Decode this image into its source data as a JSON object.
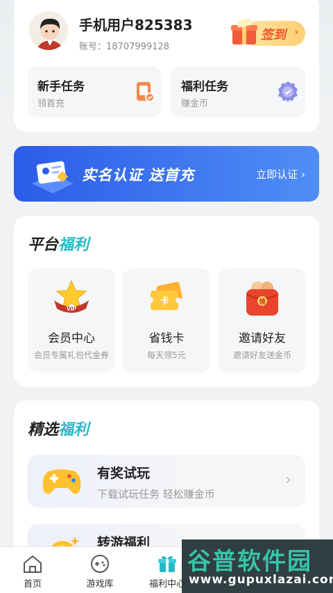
{
  "profile": {
    "username": "手机用户825383",
    "account": "账号：18707999128",
    "signin_label": "签到"
  },
  "tasks": [
    {
      "title": "新手任务",
      "subtitle": "领首充",
      "icon": "phone-task-icon"
    },
    {
      "title": "福利任务",
      "subtitle": "赚金币",
      "icon": "badge-icon"
    }
  ],
  "banner": {
    "title": "实名认证 送首充",
    "link": "立即认证 ›"
  },
  "platform": {
    "title_a": "平台",
    "title_b": "福利",
    "items": [
      {
        "title": "会员中心",
        "subtitle": "会员专属礼包代金券",
        "icon": "vip-crown-icon"
      },
      {
        "title": "省钱卡",
        "subtitle": "每天领5元",
        "icon": "ticket-card-icon"
      },
      {
        "title": "邀请好友",
        "subtitle": "邀请好友送金币",
        "icon": "red-envelope-icon"
      }
    ]
  },
  "featured": {
    "title_a": "精选",
    "title_b": "福利",
    "items": [
      {
        "title": "有奖试玩",
        "subtitle": "下载试玩任务 轻松赚金币",
        "icon": "gamepad-icon"
      },
      {
        "title": "转游福利",
        "subtitle": "",
        "icon": "coin-icon"
      }
    ]
  },
  "tabs": [
    {
      "label": "首页",
      "icon": "home-icon"
    },
    {
      "label": "游戏库",
      "icon": "game-library-icon"
    },
    {
      "label": "福利中心",
      "icon": "gift-icon"
    }
  ],
  "watermark": {
    "line1": "谷普软件园",
    "line2": "www.gupuxlazai.com"
  },
  "colors": {
    "accent": "#27b8c8",
    "banner": "#3a73ee",
    "signin": "#f2542a"
  }
}
